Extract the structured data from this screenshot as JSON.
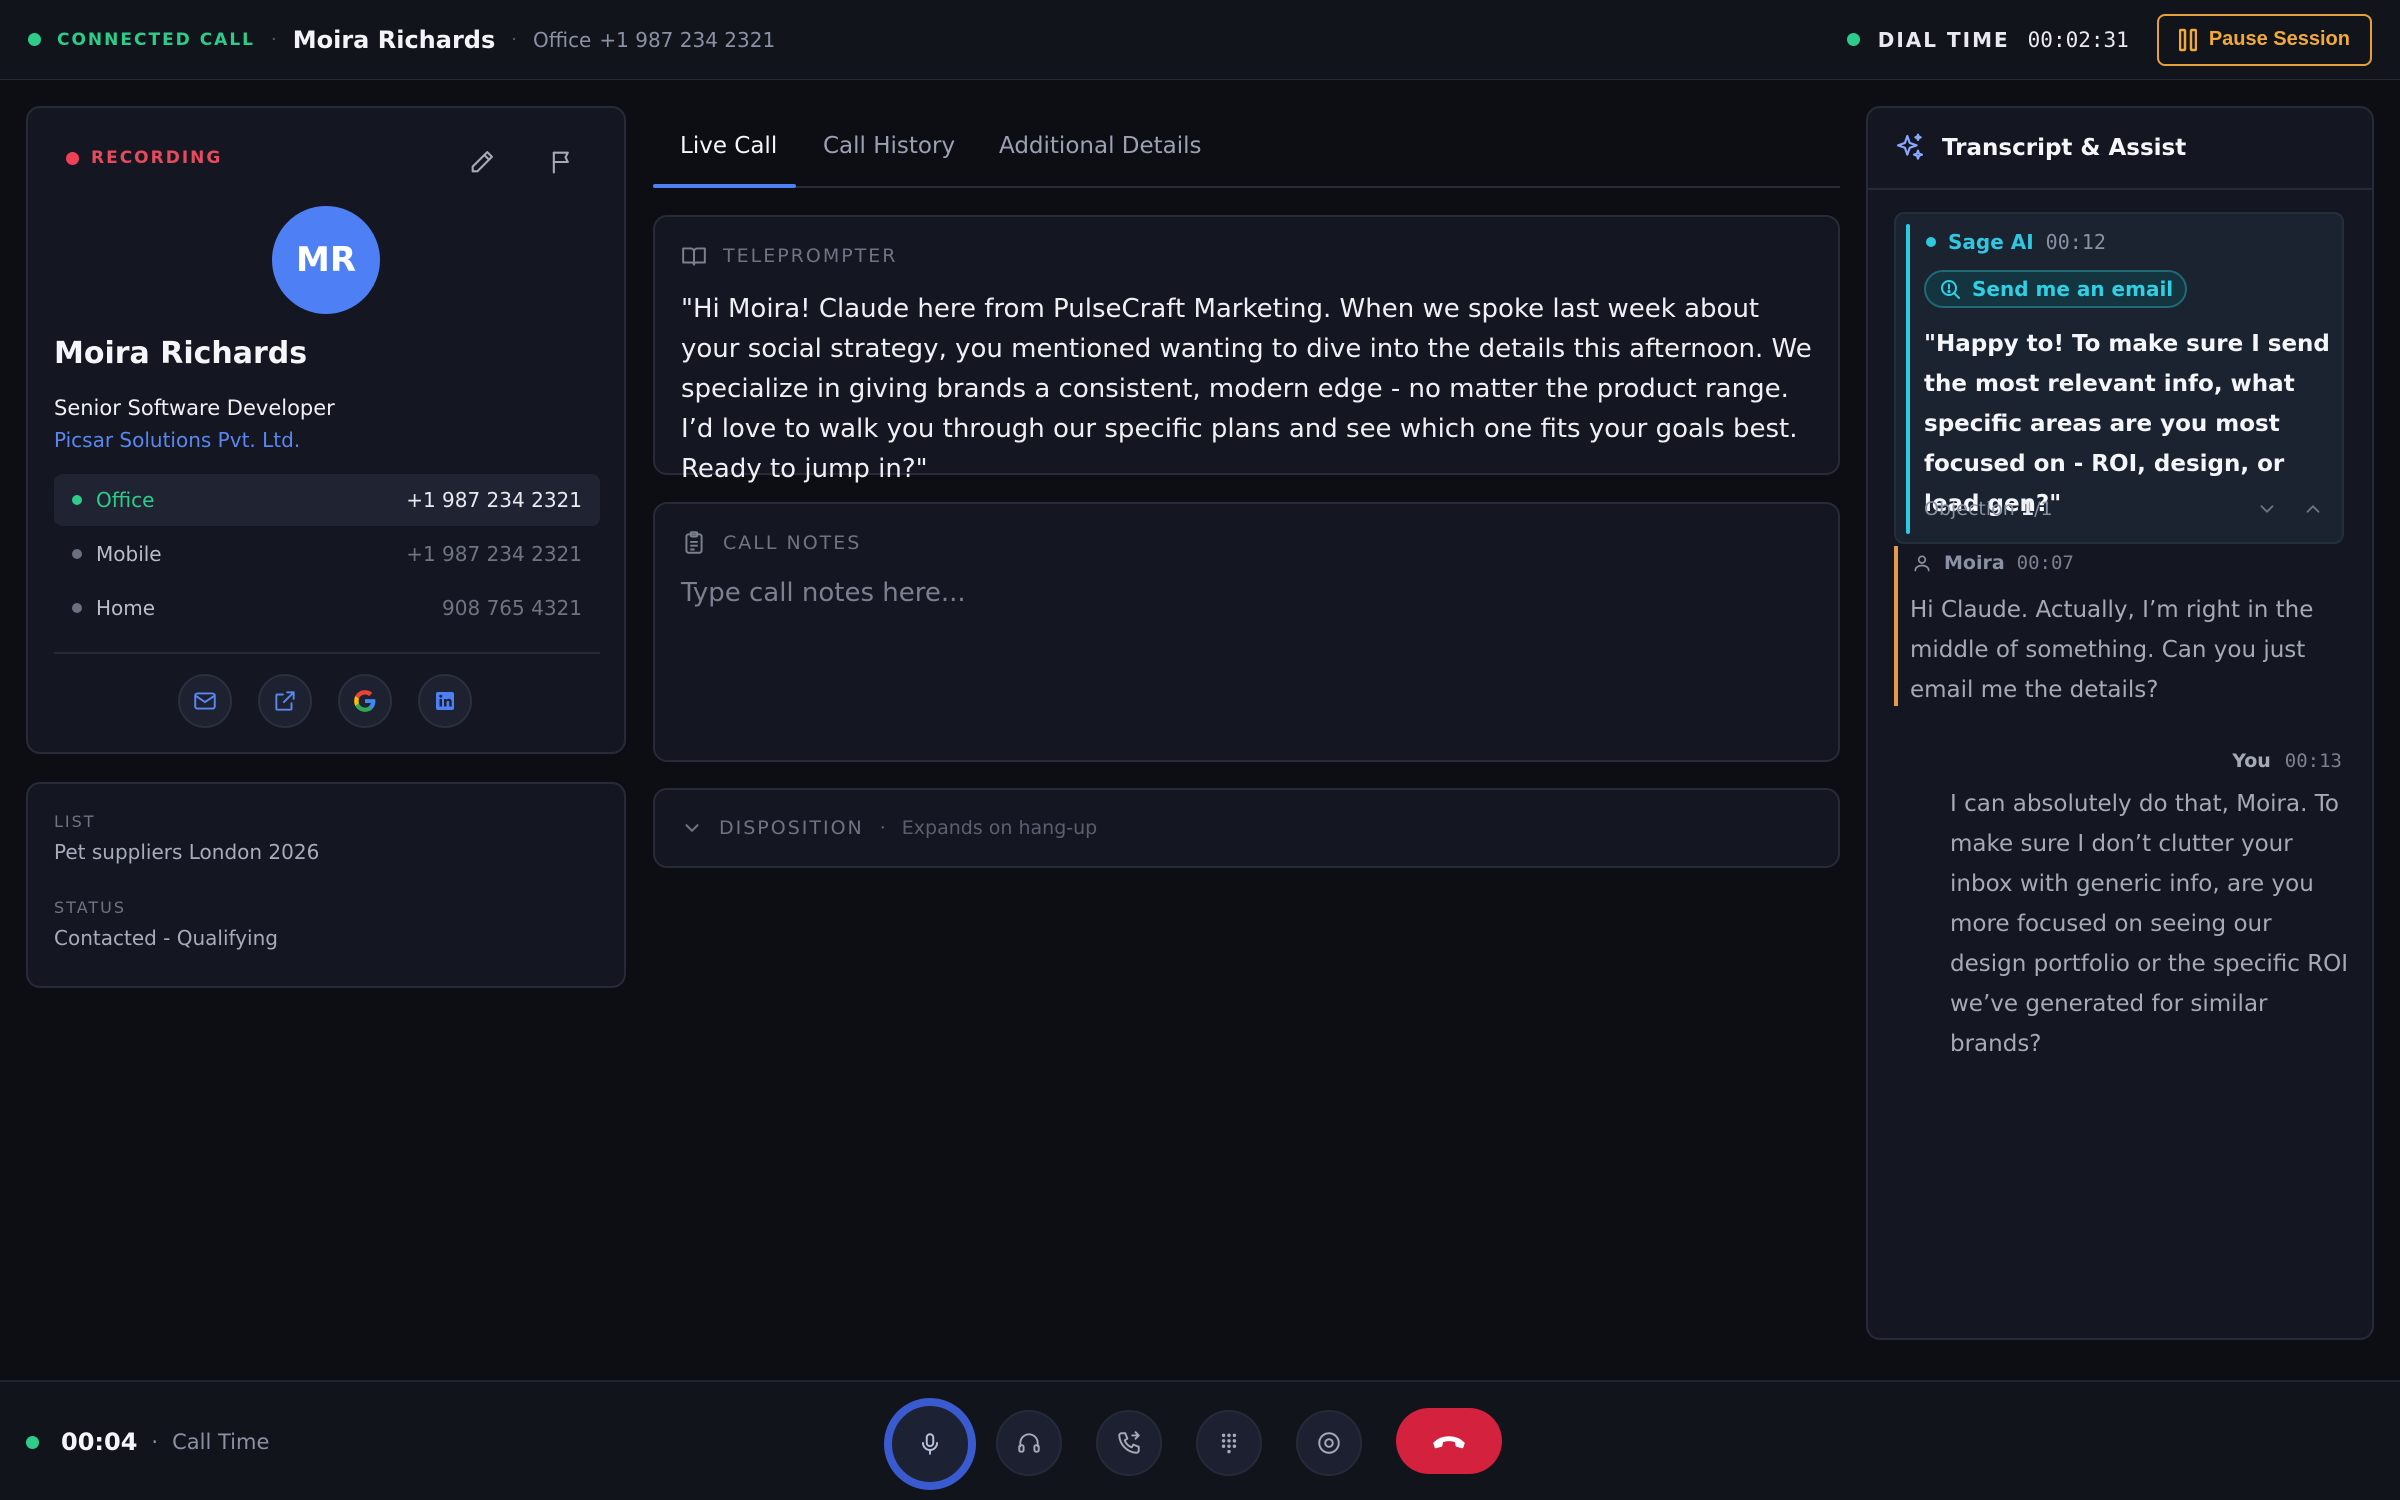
{
  "topbar": {
    "status": "CONNECTED CALL",
    "separator": "·",
    "contact_name": "Moira Richards",
    "phone_type": "Office",
    "phone_number": "+1 987 234 2321",
    "dial_time_label": "DIAL TIME",
    "dial_time": "00:02:31",
    "pause_label": "Pause Session"
  },
  "contact": {
    "recording_label": "RECORDING",
    "initials": "MR",
    "name": "Moira Richards",
    "title": "Senior Software Developer",
    "company": "Picsar Solutions Pvt. Ltd.",
    "phones": [
      {
        "label": "Office",
        "number": "+1 987 234 2321"
      },
      {
        "label": "Mobile",
        "number": "+1 987 234 2321"
      },
      {
        "label": "Home",
        "number": "908 765 4321"
      }
    ],
    "socials": [
      "mail-icon",
      "external-link-icon",
      "google-icon",
      "linkedin-icon"
    ]
  },
  "meta": {
    "list_label": "LIST",
    "list_value": "Pet suppliers London 2026",
    "status_label": "STATUS",
    "status_value": "Contacted - Qualifying"
  },
  "tabs": [
    "Live Call",
    "Call History",
    "Additional Details"
  ],
  "teleprompter": {
    "title": "TELEPROMPTER",
    "text": "\"Hi Moira! Claude here from PulseCraft Marketing. When we spoke last week about your social strategy, you mentioned wanting to dive into the details this afternoon. We specialize in giving brands a consistent, modern edge - no matter the product range. I’d love to walk you through our specific plans and see which one fits your goals best. Ready to jump in?\""
  },
  "notes": {
    "title": "CALL NOTES",
    "placeholder": "Type call notes here..."
  },
  "disposition": {
    "title": "DISPOSITION",
    "separator": "·",
    "hint": "Expands on hang-up"
  },
  "assist": {
    "title": "Transcript & Assist",
    "ai": {
      "name": "Sage AI",
      "time": "00:12",
      "tag": "Send me an email",
      "text": "\"Happy to! To make sure I send the most relevant info, what specific areas are you most focused on - ROI, design, or lead gen?\"",
      "objection_label": "Objection",
      "objection_current": "1",
      "objection_total": "/1"
    },
    "moira": {
      "name": "Moira",
      "time": "00:07",
      "text": "Hi Claude. Actually, I’m right in the middle of something. Can you just email me the details?"
    },
    "you": {
      "name": "You",
      "time": "00:13",
      "text": "I can absolutely do that, Moira. To make sure I don’t clutter your inbox with generic info, are you more focused on seeing our design portfolio or the specific ROI we’ve generated for similar brands?"
    }
  },
  "bottombar": {
    "call_time": "00:04",
    "separator": "·",
    "call_time_label": "Call Time"
  },
  "colors": {
    "accent": "#4f7ff5",
    "success": "#2ecc8a",
    "recording": "#ee4156",
    "warning": "#e5a23a",
    "ai": "#2fc8e0",
    "hangup": "#d4213e"
  }
}
